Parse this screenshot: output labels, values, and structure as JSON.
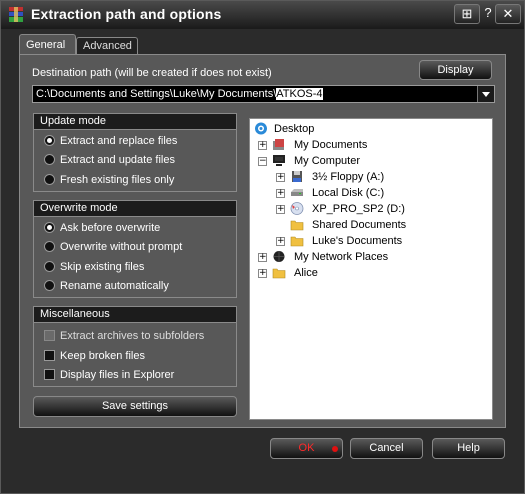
{
  "window": {
    "title": "Extraction path and options",
    "controls": [
      "⊞",
      "?",
      "✕"
    ]
  },
  "tabs": [
    {
      "label": "General",
      "active": true
    },
    {
      "label": "Advanced",
      "active": false
    }
  ],
  "destination": {
    "label": "Destination path (will be created if does not exist)",
    "display_button": "Display",
    "path_prefix": "C:\\Documents and Settings\\Luke\\My Documents\\",
    "path_selected": "ATKOS-4"
  },
  "update_mode": {
    "header": "Update mode",
    "options": [
      {
        "label": "Extract and replace files",
        "selected": true
      },
      {
        "label": "Extract and update files",
        "selected": false
      },
      {
        "label": "Fresh existing files only",
        "selected": false
      }
    ]
  },
  "overwrite_mode": {
    "header": "Overwrite mode",
    "options": [
      {
        "label": "Ask before overwrite",
        "selected": true
      },
      {
        "label": "Overwrite without prompt",
        "selected": false
      },
      {
        "label": "Skip existing files",
        "selected": false
      },
      {
        "label": "Rename automatically",
        "selected": false
      }
    ]
  },
  "misc": {
    "header": "Miscellaneous",
    "options": [
      {
        "label": "Extract archives to subfolders",
        "checked": false
      },
      {
        "label": "Keep broken files",
        "checked": false
      },
      {
        "label": "Display files in Explorer",
        "checked": false
      }
    ]
  },
  "save_button": "Save settings",
  "tree": [
    {
      "label": "Desktop",
      "icon": "desktop-icon"
    },
    {
      "label": "My Documents",
      "icon": "my-documents-icon"
    },
    {
      "label": "My Computer",
      "icon": "computer-icon"
    },
    {
      "label": "3½ Floppy (A:)",
      "icon": "floppy-icon"
    },
    {
      "label": "Local Disk (C:)",
      "icon": "disk-icon"
    },
    {
      "label": "XP_PRO_SP2 (D:)",
      "icon": "cd-icon"
    },
    {
      "label": "Shared Documents",
      "icon": "folder-icon"
    },
    {
      "label": "Luke's Documents",
      "icon": "folder-icon"
    },
    {
      "label": "My Network Places",
      "icon": "network-icon"
    },
    {
      "label": "Alice",
      "icon": "folder-icon"
    }
  ],
  "footer": {
    "ok": "OK",
    "cancel": "Cancel",
    "help": "Help"
  },
  "colors": {
    "ok_text": "#ff2a2a",
    "ok_dot": "#e01010"
  }
}
